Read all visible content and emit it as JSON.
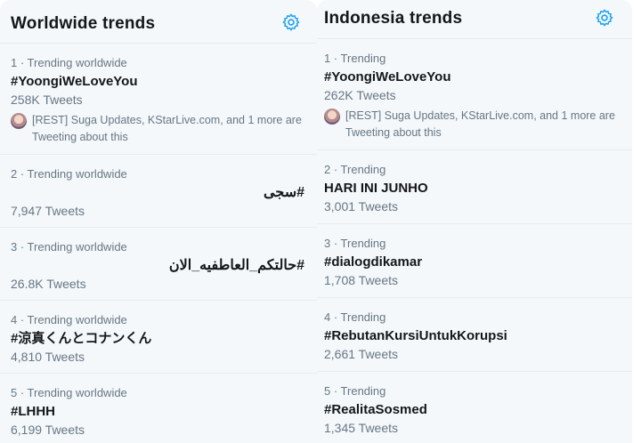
{
  "left": {
    "title": "Worldwide trends",
    "settings_icon": "gear-icon",
    "trends": [
      {
        "meta": "1 · Trending worldwide",
        "name": "#YoongiWeLoveYou",
        "count": "258K Tweets",
        "context": "[REST] Suga Updates, KStarLive.com, and 1 more are Tweeting about this"
      },
      {
        "meta": "2 · Trending worldwide",
        "name": "#سجى",
        "count": "7,947 Tweets"
      },
      {
        "meta": "3 · Trending worldwide",
        "name": "#حالتكم_العاطفيه_الان",
        "count": "26.8K Tweets"
      },
      {
        "meta": "4 · Trending worldwide",
        "name": "#涼真くんとコナンくん",
        "count": "4,810 Tweets"
      },
      {
        "meta": "5 · Trending worldwide",
        "name": "#LHHH",
        "count": "6,199 Tweets"
      }
    ]
  },
  "right": {
    "title": "Indonesia trends",
    "settings_icon": "gear-icon",
    "trends": [
      {
        "meta": "1 · Trending",
        "name": "#YoongiWeLoveYou",
        "count": "262K Tweets",
        "context": "[REST] Suga Updates, KStarLive.com, and 1 more are Tweeting about this"
      },
      {
        "meta": "2 · Trending",
        "name": "HARI INI JUNHO",
        "count": "3,001 Tweets"
      },
      {
        "meta": "3 · Trending",
        "name": "#dialogdikamar",
        "count": "1,708 Tweets"
      },
      {
        "meta": "4 · Trending",
        "name": "#RebutanKursiUntukKorupsi",
        "count": "2,661 Tweets"
      },
      {
        "meta": "5 · Trending",
        "name": "#RealitaSosmed",
        "count": "1,345 Tweets"
      }
    ]
  },
  "colors": {
    "accent": "#1da1f2",
    "muted": "#657786",
    "panel": "#f5f8fa",
    "divider": "#e6ecf0"
  }
}
